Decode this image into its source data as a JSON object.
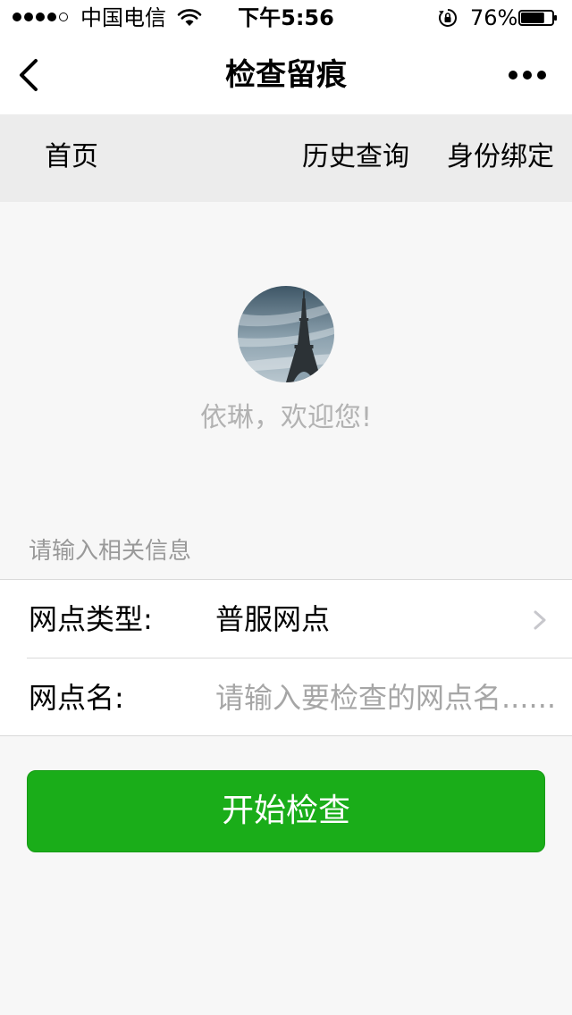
{
  "status_bar": {
    "signal_bars_filled": 4,
    "signal_bars_total": 5,
    "carrier": "中国电信",
    "time": "下午5:56",
    "battery_percent": "76%",
    "battery_level": 0.76,
    "icons": [
      "wifi-icon",
      "rotation-lock-icon",
      "battery-icon"
    ]
  },
  "nav": {
    "title": "检查留痕",
    "back_icon": "chevron-left-icon",
    "more_icon": "more-dots-icon"
  },
  "tabs": {
    "home": "首页",
    "history": "历史查询",
    "bind": "身份绑定"
  },
  "profile": {
    "welcome": "依琳，欢迎您!"
  },
  "form": {
    "hint": "请输入相关信息",
    "type_label": "网点类型:",
    "type_value": "普服网点",
    "name_label": "网点名:",
    "name_placeholder": "请输入要检查的网点名......",
    "name_value": ""
  },
  "actions": {
    "start_label": "开始检查"
  },
  "colors": {
    "primary_button": "#1aad19",
    "tab_bar_bg": "#ececec",
    "page_bg": "#f7f7f7"
  }
}
